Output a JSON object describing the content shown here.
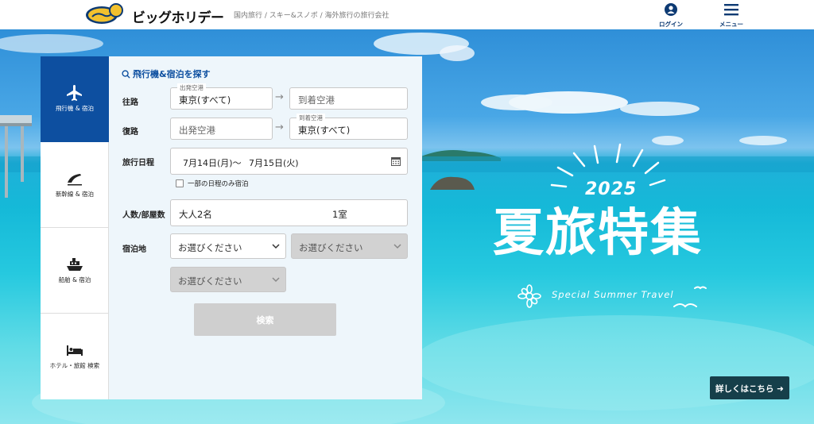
{
  "header": {
    "brand": "ビッグホリデー",
    "tagline": "国内旅行 / スキー&スノボ / 海外旅行の旅行会社",
    "login_label": "ログイン",
    "menu_label": "メニュー"
  },
  "tabs": [
    {
      "label": "飛行機 & 宿泊",
      "icon": "airplane-icon",
      "active": true
    },
    {
      "label": "新幹線 & 宿泊",
      "icon": "shinkansen-icon",
      "active": false
    },
    {
      "label": "船舶 & 宿泊",
      "icon": "ship-icon",
      "active": false
    },
    {
      "label": "ホテル・旅館 検索",
      "icon": "bed-icon",
      "active": false
    }
  ],
  "form": {
    "title": "飛行機&宿泊を探す",
    "outbound_label": "往路",
    "return_label": "復路",
    "dates_label": "旅行日程",
    "people_label": "人数/部屋数",
    "lodging_label": "宿泊地",
    "outbound": {
      "departure_label": "出発空港",
      "departure_value": "東京(すべて)",
      "arrival_placeholder": "到着空港"
    },
    "return": {
      "departure_placeholder": "出発空港",
      "arrival_label": "到着空港",
      "arrival_value": "東京(すべて)"
    },
    "dates": {
      "start": "7月14日(月)～",
      "end": "7月15日(火)"
    },
    "partial_stay_label": "一部の日程のみ宿泊",
    "people": {
      "adults": "大人2名",
      "rooms": "1室"
    },
    "lodging_select_1": "お選びください",
    "lodging_select_2": "お選びください",
    "lodging_select_3": "お選びください",
    "search_label": "検索"
  },
  "banner": {
    "year": "2025",
    "headline": "夏旅特集",
    "subhead": "Special Summer Travel",
    "details_label": "詳しくはこちら ➜"
  },
  "colors": {
    "primary": "#0d4fa0",
    "navy": "#0d3a73",
    "form_bg": "#eef6fb",
    "details_button": "#163f4a",
    "disabled": "#d2d2d2"
  }
}
